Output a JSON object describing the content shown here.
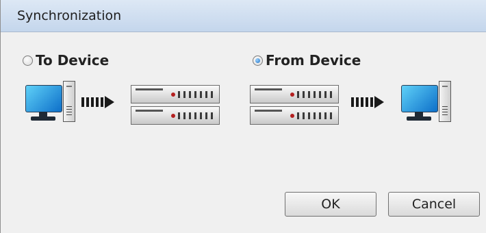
{
  "window": {
    "title": "Synchronization"
  },
  "options": [
    {
      "label": "To Device",
      "selected": false
    },
    {
      "label": "From Device",
      "selected": true
    }
  ],
  "buttons": {
    "ok_label": "OK",
    "cancel_label": "Cancel"
  },
  "colors": {
    "accent": "#1d6fc1",
    "monitor": "#2ea8e6",
    "titlebar": "#c4d6ec"
  },
  "icons": [
    "computer-icon",
    "arrow-right-icon",
    "device-rack-icon"
  ]
}
